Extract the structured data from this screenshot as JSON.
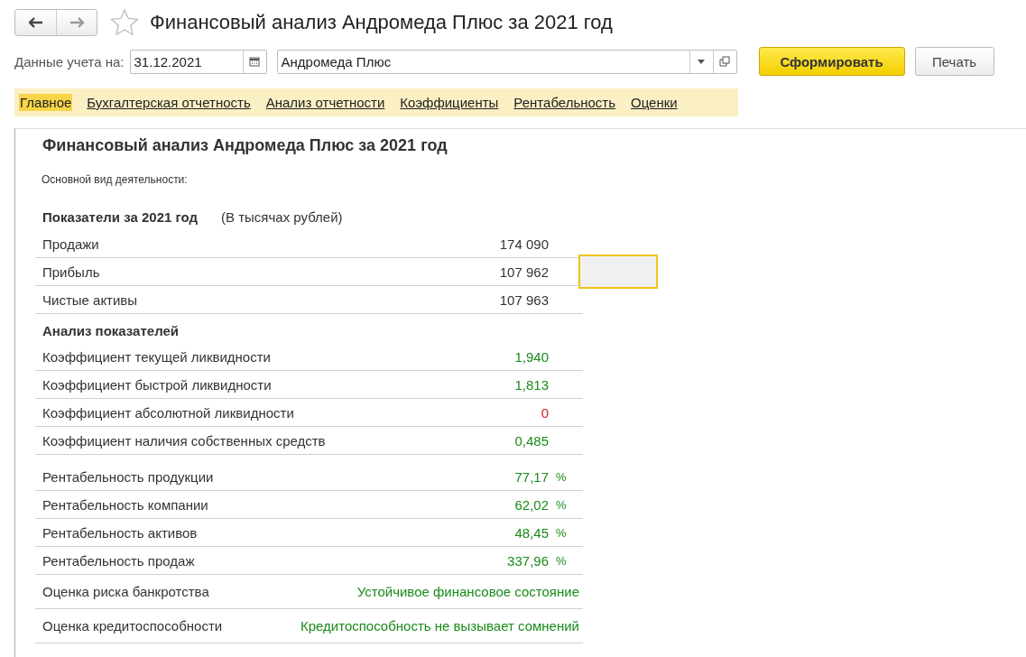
{
  "window": {
    "title": "Финансовый анализ Андромеда Плюс за 2021 год",
    "favorite": false
  },
  "toolbar": {
    "date_label": "Данные учета на:",
    "date_value": "31.12.2021",
    "organization_value": "Андромеда Плюс",
    "buttons": [
      {
        "label": "Сформировать",
        "kind": "primary"
      },
      {
        "label": "Печать",
        "kind": "default"
      }
    ]
  },
  "tabs": [
    {
      "label": "Главное",
      "selected": true
    },
    {
      "label": "Бухгалтерская отчетность",
      "selected": false
    },
    {
      "label": "Анализ отчетности",
      "selected": false
    },
    {
      "label": "Коэффициенты",
      "selected": false
    },
    {
      "label": "Рентабельность",
      "selected": false
    },
    {
      "label": "Оценки",
      "selected": false
    }
  ],
  "report": {
    "title": "Финансовый анализ Андромеда Плюс за 2021 год",
    "activity_label": "Основной вид деятельности:",
    "indicators_heading": "Показатели за 2021 год",
    "indicators_unit": "(В тысячах рублей)",
    "indicators": [
      {
        "name": "Продажи",
        "value": "174 090",
        "selected": false
      },
      {
        "name": "Прибыль",
        "value": "107 962",
        "selected": true
      },
      {
        "name": "Чистые активы",
        "value": "107 963",
        "selected": false
      }
    ],
    "analysis_heading": "Анализ показателей",
    "ratios": [
      {
        "name": "Коэффициент текущей ликвидности",
        "value": "1,940",
        "color": "#1a8a1a"
      },
      {
        "name": "Коэффициент быстрой ликвидности",
        "value": "1,813",
        "color": "#1a8a1a"
      },
      {
        "name": "Коэффициент абсолютной ликвидности",
        "value": "0",
        "color": "#d62020"
      },
      {
        "name": "Коэффициент наличия собственных средств",
        "value": "0,485",
        "color": "#1a8a1a"
      }
    ],
    "profitability": [
      {
        "name": "Рентабельность продукции",
        "value": "77,17",
        "unit": "%",
        "color": "#1a8a1a"
      },
      {
        "name": "Рентабельность компании",
        "value": "62,02",
        "unit": "%",
        "color": "#1a8a1a"
      },
      {
        "name": "Рентабельность активов",
        "value": "48,45",
        "unit": "%",
        "color": "#1a8a1a"
      },
      {
        "name": "Рентабельность продаж",
        "value": "337,96",
        "unit": "%",
        "color": "#1a8a1a"
      }
    ],
    "assessments": [
      {
        "name": "Оценка риска банкротства",
        "value": "Устойчивое финансовое состояние",
        "color": "#1a8a1a"
      },
      {
        "name": "Оценка кредитоспособности",
        "value": "Кредитоспособность не вызывает сомнений",
        "color": "#1a8a1a"
      }
    ]
  }
}
